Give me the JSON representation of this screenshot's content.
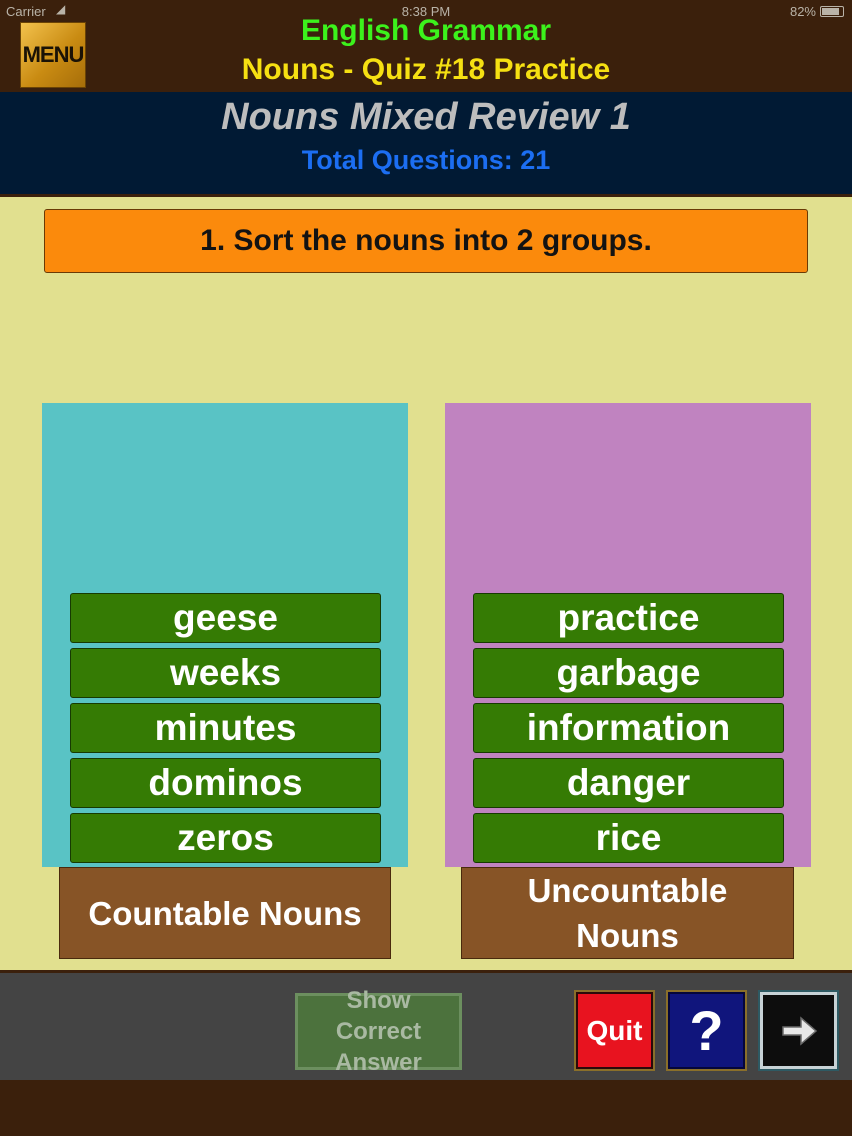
{
  "status_bar": {
    "carrier": "Carrier",
    "wifi_icon": "wifi-icon",
    "time": "8:38 PM",
    "battery": "82%"
  },
  "header": {
    "menu_label": "MENU",
    "app_title": "English Grammar",
    "quiz_title": "Nouns - Quiz #18 Practice"
  },
  "banner": {
    "title": "Nouns Mixed Review 1",
    "total": "Total Questions: 21"
  },
  "question": {
    "text": "1. Sort the nouns into 2 groups."
  },
  "groups": [
    {
      "label": "Countable Nouns",
      "color": "#59c3c5",
      "words": [
        "geese",
        "weeks",
        "minutes",
        "dominos",
        "zeros"
      ]
    },
    {
      "label": "Uncountable Nouns",
      "color": "#c083c0",
      "words": [
        "practice",
        "garbage",
        "information",
        "danger",
        "rice"
      ]
    }
  ],
  "toolbar": {
    "show_answer_line1": "Show",
    "show_answer_line2": "Correct Answer",
    "quit_label": "Quit",
    "help_label": "?",
    "next_icon": "arrow-right-icon"
  },
  "colors": {
    "brown": "#3b200c",
    "word_tile": "#357b04",
    "question_bg": "#fb8a0c",
    "panel_bg": "#e1e08f"
  }
}
